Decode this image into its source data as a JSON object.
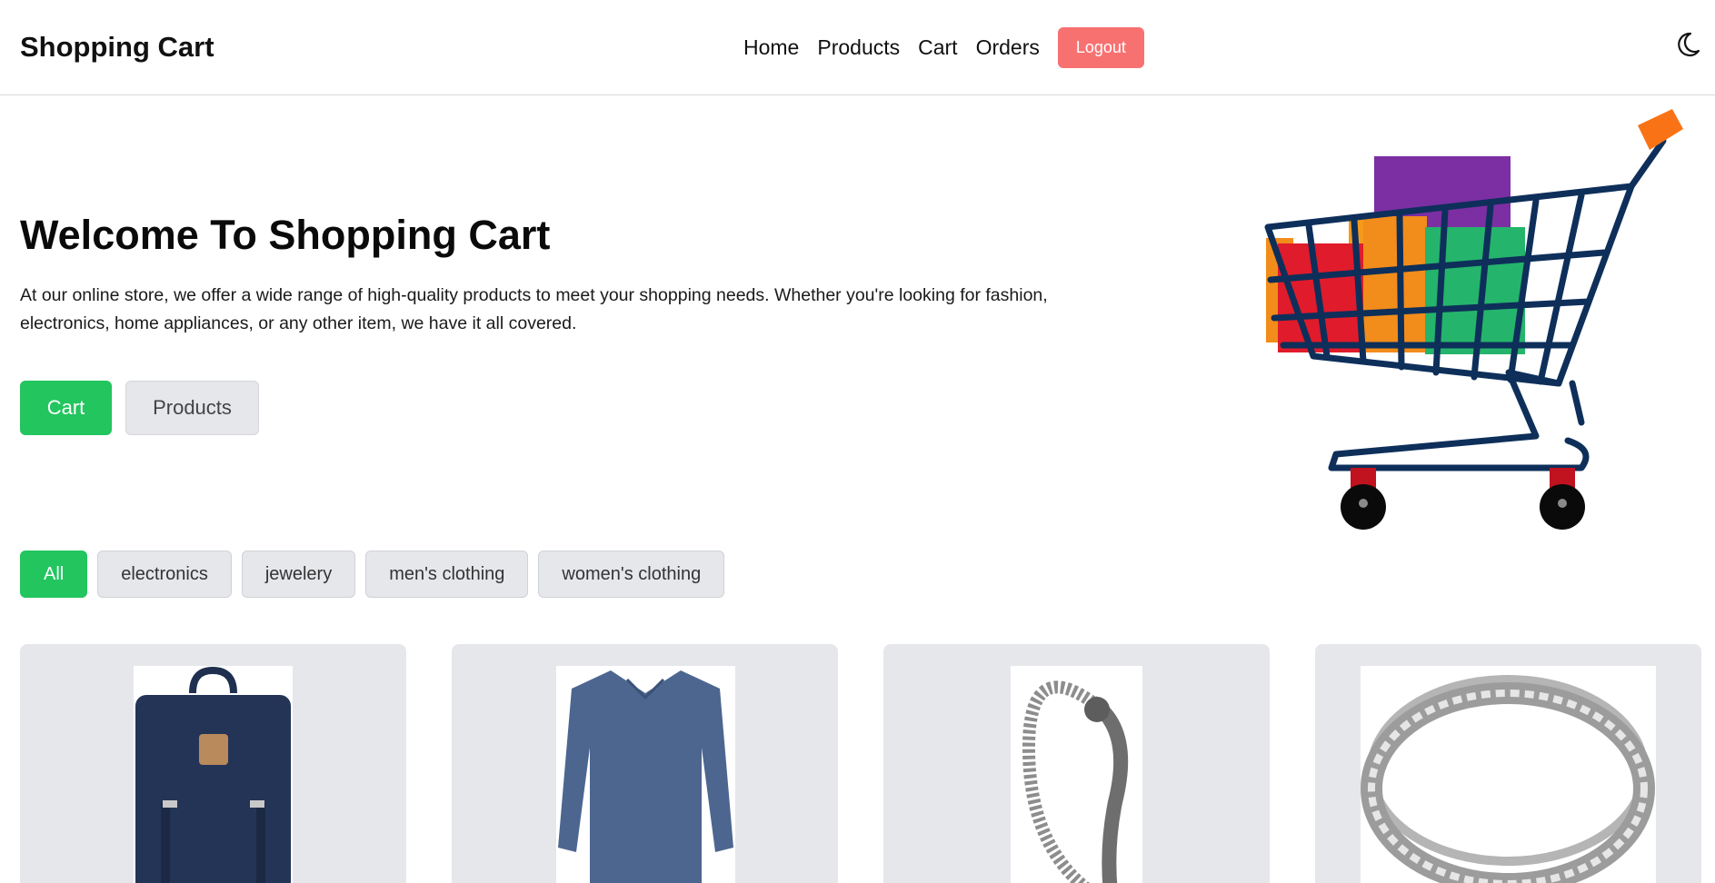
{
  "navbar": {
    "brand": "Shopping Cart",
    "links": [
      "Home",
      "Products",
      "Cart",
      "Orders"
    ],
    "logout_label": "Logout",
    "theme_icon": "moon-icon"
  },
  "hero": {
    "title": "Welcome To Shopping Cart",
    "description": "At our online store, we offer a wide range of high-quality products to meet your shopping needs. Whether you're looking for fashion, electronics, home appliances, or any other item, we have it all covered.",
    "cart_button": "Cart",
    "products_button": "Products",
    "image": "shopping-cart-illustration"
  },
  "filters": {
    "options": [
      "All",
      "electronics",
      "jewelery",
      "men's clothing",
      "women's clothing"
    ],
    "selected": "All"
  },
  "products": [
    {
      "image": "backpack"
    },
    {
      "image": "mens-shirt"
    },
    {
      "image": "bracelet"
    },
    {
      "image": "ring"
    }
  ],
  "colors": {
    "accent": "#22c55e",
    "logout": "#f87171",
    "chip_bg": "#e5e7eb",
    "card_bg": "#e5e7eb"
  }
}
